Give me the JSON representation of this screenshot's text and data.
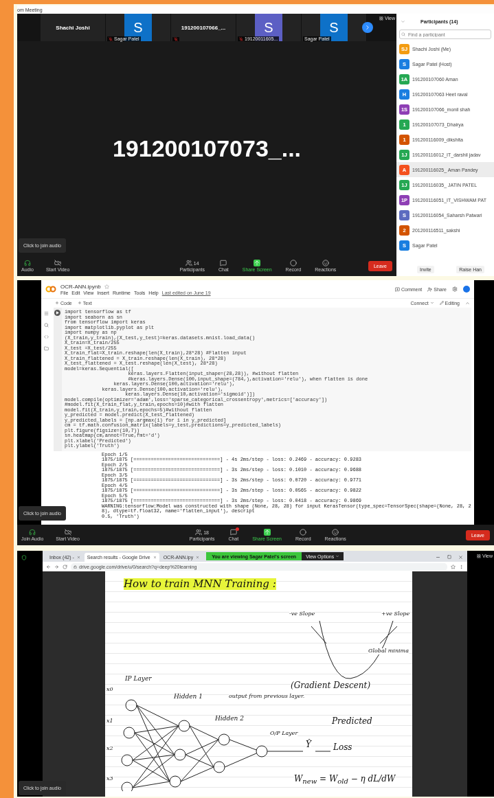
{
  "meeting_window": {
    "title": "om Meeting",
    "view_label": "View",
    "tiles": [
      {
        "kind": "name",
        "name": "Shachi Joshi",
        "muted": false
      },
      {
        "kind": "avatar",
        "initial": "S",
        "color": "#0e71c8",
        "label": "Sagar Patel",
        "muted": true
      },
      {
        "kind": "name",
        "name": "191200107066_...",
        "muted": true
      },
      {
        "kind": "avatar",
        "initial": "S",
        "color": "#5c5fc4",
        "label": "19120011605...",
        "muted": true
      },
      {
        "kind": "avatar",
        "initial": "S",
        "color": "#0e71c8",
        "label": "Sagar Patel",
        "muted": false
      }
    ],
    "speaker": "191200107073_...",
    "audio_tip": "Click to join audio",
    "toolbar": [
      {
        "kind": "audio",
        "label": "Audio"
      },
      {
        "kind": "video",
        "label": "Start Video"
      },
      {
        "kind": "participants",
        "label": "Participants",
        "count": "14"
      },
      {
        "kind": "chat",
        "label": "Chat",
        "unread": false
      },
      {
        "kind": "share",
        "label": "Share Screen"
      },
      {
        "kind": "record",
        "label": "Record"
      },
      {
        "kind": "reactions",
        "label": "Reactions"
      }
    ],
    "leave": "Leave"
  },
  "participants": {
    "title": "Participants (14)",
    "search": {
      "placeholder": "Find a participant"
    },
    "items": [
      {
        "initials": "SJ",
        "name": "Shachi Joshi (Me)",
        "color": "#f39c12",
        "selected": false
      },
      {
        "initials": "S",
        "name": "Sagar Patel (Host)",
        "color": "#1a7ee0",
        "selected": false
      },
      {
        "initials": "1A",
        "name": "191200107060 Aman",
        "color": "#25a853",
        "selected": false
      },
      {
        "initials": "H",
        "name": "191200107063 Heet raval",
        "color": "#1a7ee0",
        "selected": false
      },
      {
        "initials": "1S",
        "name": "191200107066_monil shah",
        "color": "#8e3fb5",
        "selected": false
      },
      {
        "initials": "1",
        "name": "191200107073_Dhairya",
        "color": "#25a853",
        "selected": false
      },
      {
        "initials": "1",
        "name": "191200116009_dikshita",
        "color": "#d35400",
        "selected": false
      },
      {
        "initials": "1J",
        "name": "191200116012_IT_darshil jadav",
        "color": "#25a853",
        "selected": false
      },
      {
        "initials": "A",
        "name": "191200116025_ Aman Pandey",
        "color": "#f4511e",
        "selected": true
      },
      {
        "initials": "1J",
        "name": "191200116035_ JATIN PATEL",
        "color": "#25a853",
        "selected": false
      },
      {
        "initials": "1P",
        "name": "191200116051_IT_VISHWAM PAT",
        "color": "#8e3fb5",
        "selected": false
      },
      {
        "initials": "S",
        "name": "191200116054_Saharsh Patwari",
        "color": "#5c6bc0",
        "selected": false
      },
      {
        "initials": "2",
        "name": "201200116511_sakshi",
        "color": "#d35400",
        "selected": false
      },
      {
        "initials": "S",
        "name": "Sagar Patel",
        "color": "#1a7ee0",
        "selected": false
      }
    ],
    "buttons": [
      "Invite",
      "Raise Han"
    ]
  },
  "colab_share": {
    "file": "OCR-ANN.ipynb",
    "menu": [
      "File",
      "Edit",
      "View",
      "Insert",
      "Runtime",
      "Tools",
      "Help"
    ],
    "last_edited": "Last edited on June 19",
    "actions": [
      "Comment",
      "Share"
    ],
    "add": [
      "Code",
      "Text"
    ],
    "connect": "Connect",
    "editing": "Editing",
    "code": [
      "import tensorflow as tf",
      "import seaborn as sn",
      "from tensorflow import keras",
      "import matplotlib.pyplot as plt",
      "import numpy as np",
      "(X_train,y_train),(X_test,y_test)=keras.datasets.mnist.load_data()",
      "X_train=X_train/255",
      "X_test =X_test/255",
      "X_train_flat=X_train.reshape(len(X_train),28*28) #Flatten input",
      "X_train_flattened = X_train.reshape(len(X_train), 28*28)",
      "X_test_flattened = X_test.reshape(len(X_test), 28*28)",
      "model=keras.Sequential([",
      "                      keras.layers.Flatten(input_shape=(28,28)), #without flatten",
      "                      #keras.layers.Dense(100,input_shape=(784,),activation='relu'), when flatten is done",
      "                 keras.layers.Dense(100,activation='relu'),",
      "             keras.layers.Dense(100,activation='relu'),",
      "                     keras.layers.Dense(10,activation='sigmoid')])",
      "model.compile(optimizer='adam',loss='sparse_categorical_crossentropy',metrics=['accuracy'])",
      "#model.fit(X_train_flat,y_train,epochs=10)#with flatten",
      "model.fit(X_train,y_train,epochs=5)#without flatten",
      "y_predicted = model.predict(X_test_flattened)",
      "y_predicted_labels = [np.argmax(i) for i in y_predicted]",
      "cm = tf.math.confusion_matrix(labels=y_test,predictions=y_predicted_labels)",
      "plt.figure(figsize=(10,7))",
      "sn.heatmap(cm,annot=True,fmt='d')",
      "plt.xlabel('Predicted')",
      "plt.ylabel('Truth')"
    ],
    "output": [
      "Epoch 1/5",
      "1875/1875 [==============================] - 4s 2ms/step - loss: 0.2469 - accuracy: 0.9283",
      "Epoch 2/5",
      "1875/1875 [==============================] - 3s 2ms/step - loss: 0.1010 - accuracy: 0.9688",
      "Epoch 3/5",
      "1875/1875 [==============================] - 3s 2ms/step - loss: 0.0720 - accuracy: 0.9771",
      "Epoch 4/5",
      "1875/1875 [==============================] - 3s 2ms/step - loss: 0.0565 - accuracy: 0.9822",
      "Epoch 5/5",
      "1875/1875 [==============================] - 3s 2ms/step - loss: 0.0418 - accuracy: 0.9869",
      "WARNING:tensorflow:Model was constructed with shape (None, 28, 28) for input KerasTensor(type_spec=TensorSpec(shape=(None, 28, 28), dtype=tf.float32, name='flatten_input'), descript",
      "0.5, 'Truth')"
    ],
    "audio_tip": "Click to join audio",
    "toolbar": [
      {
        "kind": "audio",
        "label": "Join Audio"
      },
      {
        "kind": "video",
        "label": "Start Video"
      },
      {
        "kind": "participants",
        "label": "Participants",
        "count": "18"
      },
      {
        "kind": "chat",
        "label": "Chat",
        "unread": true
      },
      {
        "kind": "share",
        "label": "Share Screen"
      },
      {
        "kind": "record",
        "label": "Record"
      },
      {
        "kind": "reactions",
        "label": "Reactions"
      }
    ],
    "leave": "Leave"
  },
  "drive_share": {
    "tabs": [
      {
        "title": "Inbox (42) -",
        "selected": false
      },
      {
        "title": "Search results - Google Drive",
        "selected": true
      },
      {
        "title": "OCR-ANN.ipy",
        "selected": false
      }
    ],
    "banner": "You are viewing Sagar Patel's screen",
    "view_options": "View Options",
    "url": "drive.google.com/drive/u/0/search?q=deep%20learning",
    "view_label": "View",
    "audio_tip": "Click to join audio",
    "notes": [
      {
        "kind": "heading",
        "text": "How to train MNN Training :"
      },
      {
        "kind": "small",
        "text": "-ve Slope"
      },
      {
        "kind": "small",
        "text": "+ve Slope"
      },
      {
        "kind": "small",
        "text": "Global minima"
      },
      {
        "kind": "large",
        "text": "(Gradient Descent)"
      },
      {
        "kind": "plain",
        "text": "IP Layer"
      },
      {
        "kind": "small",
        "text": "x0"
      },
      {
        "kind": "small",
        "text": "x1"
      },
      {
        "kind": "small",
        "text": "x2"
      },
      {
        "kind": "small",
        "text": "x3"
      },
      {
        "kind": "plain",
        "text": "Hidden 1"
      },
      {
        "kind": "small",
        "text": "output from previous layer."
      },
      {
        "kind": "plain",
        "text": "Hidden 2"
      },
      {
        "kind": "large",
        "text": "Predicted"
      },
      {
        "kind": "small",
        "text": "O/P Layer"
      },
      {
        "kind": "large",
        "text": "Ŷ"
      },
      {
        "kind": "large",
        "text": "Loss"
      },
      {
        "kind": "large",
        "text": "W$_{new}$ = W$_{old}$ − η dL/dW"
      }
    ]
  }
}
